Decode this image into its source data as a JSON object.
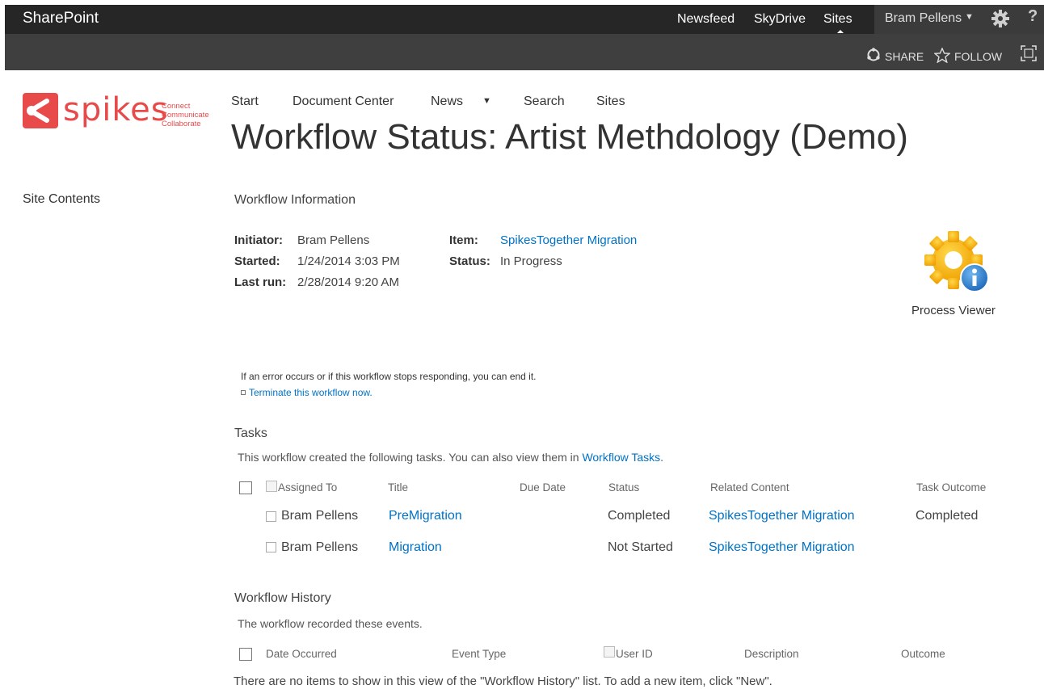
{
  "suite_bar": {
    "brand": "SharePoint",
    "links": [
      "Newsfeed",
      "SkyDrive",
      "Sites"
    ],
    "user": "Bram Pellens",
    "help": "?"
  },
  "sub_bar": {
    "share": "SHARE",
    "follow": "FOLLOW"
  },
  "logo": {
    "word": "spikes",
    "taglines": [
      "Connect",
      "Communicate",
      "Collaborate"
    ],
    "color": "#e84a4a"
  },
  "page_nav": [
    "Start",
    "Document Center",
    "News",
    "Search",
    "Sites"
  ],
  "page_title": "Workflow Status: Artist Methdology (Demo)",
  "left_nav": {
    "site_contents": "Site Contents"
  },
  "workflow_info": {
    "heading": "Workflow Information",
    "initiator_label": "Initiator:",
    "initiator": "Bram Pellens",
    "started_label": "Started:",
    "started": "1/24/2014 3:03 PM",
    "last_run_label": "Last run:",
    "last_run": "2/28/2014 9:20 AM",
    "item_label": "Item:",
    "item": "SpikesTogether Migration",
    "status_label": "Status:",
    "status": "In Progress"
  },
  "process_viewer": {
    "label": "Process Viewer"
  },
  "terminate": {
    "note": "If an error occurs or if this workflow stops responding, you can end it.",
    "link": "Terminate this workflow now."
  },
  "tasks": {
    "heading": "Tasks",
    "desc_prefix": "This workflow created the following tasks. You can also view them in",
    "desc_link": "Workflow Tasks",
    "desc_suffix": ".",
    "columns": [
      "Assigned To",
      "Title",
      "Due Date",
      "Status",
      "Related Content",
      "Task Outcome"
    ],
    "rows": [
      {
        "assigned_to": "Bram Pellens",
        "title": "PreMigration",
        "due_date": "",
        "status": "Completed",
        "related": "SpikesTogether Migration",
        "outcome": "Completed"
      },
      {
        "assigned_to": "Bram Pellens",
        "title": "Migration",
        "due_date": "",
        "status": "Not Started",
        "related": "SpikesTogether Migration",
        "outcome": ""
      }
    ]
  },
  "history": {
    "heading": "Workflow History",
    "desc": "The workflow recorded these events.",
    "columns": [
      "Date Occurred",
      "Event Type",
      "User ID",
      "Description",
      "Outcome"
    ],
    "empty": "There are no items to show in this view of the \"Workflow History\" list. To add a new item, click \"New\"."
  },
  "colors": {
    "suite_bar": "#262626",
    "sub_bar": "#3f3f3f",
    "link": "#0072c6",
    "brand": "#e84a4a"
  }
}
